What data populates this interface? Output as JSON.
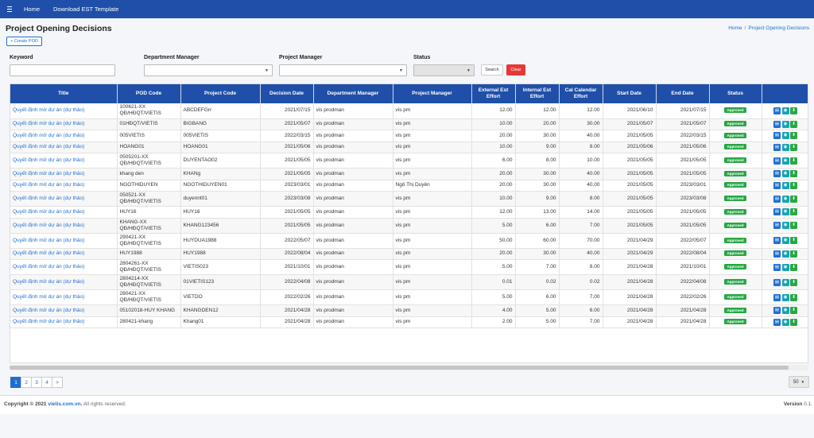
{
  "topbar": {
    "nav": [
      "Home",
      "Download EST Template"
    ]
  },
  "page": {
    "title": "Project Opening Decisions",
    "breadcrumb": [
      "Home",
      "Project Opening Decisions"
    ]
  },
  "create_button": "+ Create POD",
  "filters": {
    "keyword_label": "Keyword",
    "dept_label": "Department Manager",
    "pm_label": "Project Manager",
    "status_label": "Status",
    "search_label": "Search",
    "clear_label": "Clear"
  },
  "table": {
    "columns": [
      "Title",
      "POD Code",
      "Project Code",
      "Decision Date",
      "Department Manager",
      "Project Manager",
      "External Est Effort",
      "Internal Est Effort",
      "Cal Calendar Effort",
      "Start Date",
      "End Date",
      "Status",
      ""
    ],
    "rows": [
      {
        "title": "Quyết định mở dự án (dự thảo)",
        "pod": "100621-XX QĐ/HĐQT/VIETIS",
        "code": "ABCDEFGrr",
        "decision": "2021/07/15",
        "dept": "vis prodman",
        "pm": "vis pm",
        "ext": "12.00",
        "int": "12.00",
        "cal": "12.00",
        "start": "2021/06/10",
        "end": "2021/07/15",
        "status": "Approved"
      },
      {
        "title": "Quyết định mở dự án (dự thảo)",
        "pod": "01HĐQT/VIETIS",
        "code": "BIGBANG",
        "decision": "2021/05/07",
        "dept": "vis prodman",
        "pm": "vis pm",
        "ext": "10.00",
        "int": "20.00",
        "cal": "30.00",
        "start": "2021/05/07",
        "end": "2021/05/07",
        "status": "Approved"
      },
      {
        "title": "Quyết định mở dự án (dự thảo)",
        "pod": "005VIETIS",
        "code": "005VIETIS",
        "decision": "2022/03/15",
        "dept": "vis prodman",
        "pm": "vis pm",
        "ext": "20.00",
        "int": "30.00",
        "cal": "40.00",
        "start": "2021/05/05",
        "end": "2022/03/15",
        "status": "Approved"
      },
      {
        "title": "Quyết định mở dự án (dự thảo)",
        "pod": "HOANG01",
        "code": "HOANG01",
        "decision": "2021/05/06",
        "dept": "vis prodman",
        "pm": "vis pm",
        "ext": "10.00",
        "int": "9.00",
        "cal": "8.00",
        "start": "2021/05/06",
        "end": "2021/05/06",
        "status": "Approved"
      },
      {
        "title": "Quyết định mở dự án (dự thảo)",
        "pod": "0505201-XX QĐ/HĐQT/VIETIS",
        "code": "DUYENTAO02",
        "decision": "2021/05/05",
        "dept": "vis prodman",
        "pm": "vis pm",
        "ext": "6.00",
        "int": "8.00",
        "cal": "10.00",
        "start": "2021/05/05",
        "end": "2021/05/05",
        "status": "Approved"
      },
      {
        "title": "Quyết định mở dự án (dự thảo)",
        "pod": "khang den",
        "code": "KHANg",
        "decision": "2021/05/05",
        "dept": "vis prodman",
        "pm": "vis pm",
        "ext": "20.00",
        "int": "30.00",
        "cal": "40.00",
        "start": "2021/05/05",
        "end": "2021/05/05",
        "status": "Approved"
      },
      {
        "title": "Quyết định mở dự án (dự thảo)",
        "pod": "NGOTHIDUYEN",
        "code": "NGOTHIDUYEN01",
        "decision": "2023/03/01",
        "dept": "vis prodman",
        "pm": "Ngô Thị Duyên",
        "ext": "20.00",
        "int": "30.00",
        "cal": "40.00",
        "start": "2021/05/05",
        "end": "2023/03/01",
        "status": "Approved"
      },
      {
        "title": "Quyết định mở dự án (dự thảo)",
        "pod": "050521-XX QĐ/HĐQT/VIETIS",
        "code": "duyennt01",
        "decision": "2023/03/08",
        "dept": "vis prodman",
        "pm": "vis pm",
        "ext": "10.00",
        "int": "9.00",
        "cal": "8.00",
        "start": "2021/05/05",
        "end": "2023/03/08",
        "status": "Approved"
      },
      {
        "title": "Quyết định mở dự án (dự thảo)",
        "pod": "HUY16",
        "code": "HUY16",
        "decision": "2021/05/05",
        "dept": "vis prodman",
        "pm": "vis pm",
        "ext": "12.00",
        "int": "13.00",
        "cal": "14.00",
        "start": "2021/05/05",
        "end": "2021/05/05",
        "status": "Approved"
      },
      {
        "title": "Quyết định mở dự án (dự thảo)",
        "pod": "KHANG-XX QĐ/HĐQT/VIETIS",
        "code": "KHANG123456",
        "decision": "2021/05/05",
        "dept": "vis prodman",
        "pm": "vis pm",
        "ext": "5.00",
        "int": "6.00",
        "cal": "7.00",
        "start": "2021/05/05",
        "end": "2021/05/05",
        "status": "Approved"
      },
      {
        "title": "Quyết định mở dự án (dự thảo)",
        "pod": "290421-XX QĐ/HĐQT/VIETIS",
        "code": "HUYDUA1988",
        "decision": "2022/05/07",
        "dept": "vis prodman",
        "pm": "vis pm",
        "ext": "50.00",
        "int": "60.00",
        "cal": "70.00",
        "start": "2021/04/29",
        "end": "2022/05/07",
        "status": "Approved"
      },
      {
        "title": "Quyết định mở dự án (dự thảo)",
        "pod": "HUY1988",
        "code": "HUY1988",
        "decision": "2022/08/04",
        "dept": "vis prodman",
        "pm": "vis pm",
        "ext": "20.00",
        "int": "30.00",
        "cal": "40.00",
        "start": "2021/04/29",
        "end": "2022/08/04",
        "status": "Approved"
      },
      {
        "title": "Quyết định mở dự án (dự thảo)",
        "pod": "2804261-XX QĐ/HĐQT/VIETIS",
        "code": "VIETIS023",
        "decision": "2021/10/01",
        "dept": "vis prodman",
        "pm": "vis pm",
        "ext": "5.00",
        "int": "7.00",
        "cal": "8.00",
        "start": "2021/04/28",
        "end": "2021/10/01",
        "status": "Approved"
      },
      {
        "title": "Quyết định mở dự án (dự thảo)",
        "pod": "2804214-XX QĐ/HĐQT/VIETIS",
        "code": "01VIETIS123",
        "decision": "2022/04/08",
        "dept": "vis prodman",
        "pm": "vis pm",
        "ext": "0.01",
        "int": "0.02",
        "cal": "0.02",
        "start": "2021/04/28",
        "end": "2022/04/08",
        "status": "Approved"
      },
      {
        "title": "Quyết định mở dự án (dự thảo)",
        "pod": "280421-XX QĐ/HĐQT/VIETIS",
        "code": "VIETDO",
        "decision": "2022/02/26",
        "dept": "vis prodman",
        "pm": "vis pm",
        "ext": "5.00",
        "int": "6.00",
        "cal": "7.00",
        "start": "2021/04/28",
        "end": "2022/02/26",
        "status": "Approved"
      },
      {
        "title": "Quyết định mở dự án (dự thảo)",
        "pod": "05102018-HUY KHANG",
        "code": "KHANGDEN12",
        "decision": "2021/04/28",
        "dept": "vis prodman",
        "pm": "vis pm",
        "ext": "4.00",
        "int": "5.00",
        "cal": "6.00",
        "start": "2021/04/28",
        "end": "2021/04/28",
        "status": "Approved"
      },
      {
        "title": "Quyết định mở dự án (dự thảo)",
        "pod": "280421-khang",
        "code": "Khang01",
        "decision": "2021/04/28",
        "dept": "vis prodman",
        "pm": "vis pm",
        "ext": "2.00",
        "int": "5.00",
        "cal": "7.00",
        "start": "2021/04/28",
        "end": "2021/04/28",
        "status": "Approved"
      }
    ]
  },
  "pagination": {
    "pages": [
      "1",
      "2",
      "3",
      "4"
    ],
    "next": ">",
    "per_page": "50"
  },
  "footer": {
    "copyright_prefix": "Copyright © 2021",
    "brand": "vietis.com.vn.",
    "copyright_suffix": "All rights reserved.",
    "version_label": "Version",
    "version": "0.1."
  },
  "icons": {
    "doc": "document-icon",
    "view": "eye-icon",
    "download": "download-icon"
  },
  "colors": {
    "primary": "#1f4fa8",
    "link": "#1f6fd0",
    "approved": "#28a745",
    "clear": "#e53935"
  }
}
